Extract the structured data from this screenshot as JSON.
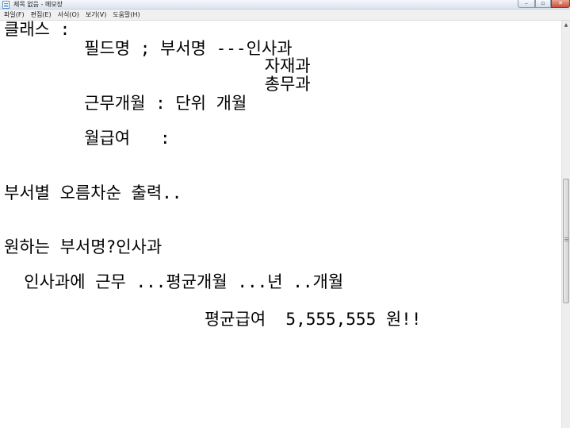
{
  "window": {
    "title": "제목 없음 - 메모장",
    "controls": {
      "minimize": "–",
      "maximize": "▫",
      "close": "✕"
    }
  },
  "menu": {
    "items": [
      {
        "label": "파일(F)"
      },
      {
        "label": "편집(E)"
      },
      {
        "label": "서식(O)"
      },
      {
        "label": "보기(V)"
      },
      {
        "label": "도움말(H)"
      }
    ]
  },
  "editor": {
    "lines": [
      "클래스 :",
      "        필드명 ; 부서명 ---인사과",
      "                          자재과",
      "                          총무과",
      "        근무개월 : 단위 개월",
      "",
      "        월급여   :",
      "",
      "",
      "부서별 오름차순 출력..",
      "",
      "",
      "원하는 부서명?인사과",
      "",
      "  인사과에 근무 ...평균개월 ...년 ..개월",
      "",
      "                    평균급여  5,555,555 원!!"
    ]
  },
  "icons": {
    "app": "notepad-icon",
    "scroll_up": "scroll-up-arrow-icon"
  }
}
